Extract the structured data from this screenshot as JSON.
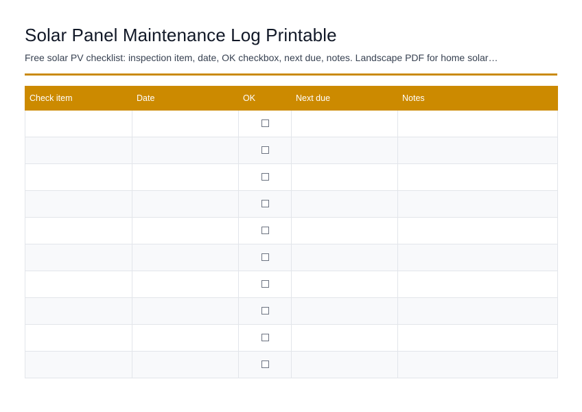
{
  "page_title": "Solar Panel Maintenance Log Printable",
  "subtitle": "Free solar PV checklist: inspection item, date, OK checkbox, next due, notes. Landscape PDF for home solar…",
  "table": {
    "headers": [
      "Check item",
      "Date",
      "OK",
      "Next due",
      "Notes"
    ],
    "rows": [
      {
        "check_item": "",
        "date": "",
        "ok": false,
        "next_due": "",
        "notes": ""
      },
      {
        "check_item": "",
        "date": "",
        "ok": false,
        "next_due": "",
        "notes": ""
      },
      {
        "check_item": "",
        "date": "",
        "ok": false,
        "next_due": "",
        "notes": ""
      },
      {
        "check_item": "",
        "date": "",
        "ok": false,
        "next_due": "",
        "notes": ""
      },
      {
        "check_item": "",
        "date": "",
        "ok": false,
        "next_due": "",
        "notes": ""
      },
      {
        "check_item": "",
        "date": "",
        "ok": false,
        "next_due": "",
        "notes": ""
      },
      {
        "check_item": "",
        "date": "",
        "ok": false,
        "next_due": "",
        "notes": ""
      },
      {
        "check_item": "",
        "date": "",
        "ok": false,
        "next_due": "",
        "notes": ""
      },
      {
        "check_item": "",
        "date": "",
        "ok": false,
        "next_due": "",
        "notes": ""
      },
      {
        "check_item": "",
        "date": "",
        "ok": false,
        "next_due": "",
        "notes": ""
      }
    ]
  },
  "colors": {
    "accent": "#cc8a00",
    "rule": "#c98a0b",
    "row_alt": "#f8f9fb",
    "grid": "#e2e5ea"
  },
  "icons": {
    "ok": "checkbox-empty-icon"
  }
}
